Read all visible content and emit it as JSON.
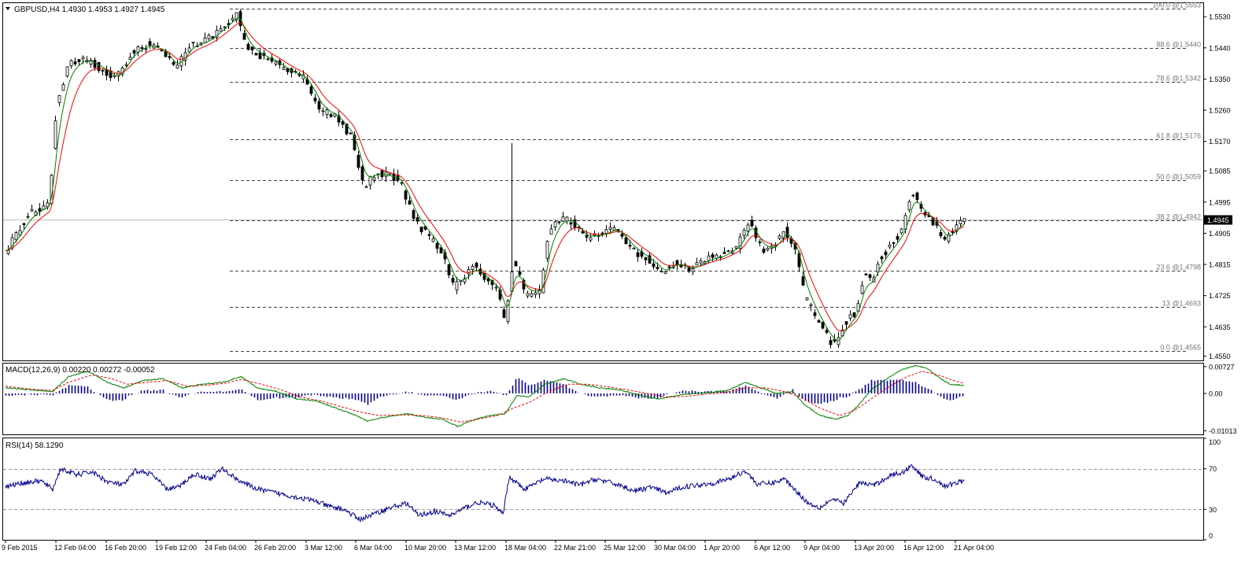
{
  "chart_data": [
    {
      "type": "candlestick",
      "symbol_header": "GBPUSD,H4  1.4930 1.4953 1.4927 1.4945",
      "current_price": "1.4945",
      "y_ticks": [
        "1.5530",
        "1.5440",
        "1.5350",
        "1.5260",
        "1.5170",
        "1.5085",
        "1.4995",
        "1.4905",
        "1.4815",
        "1.4725",
        "1.4635",
        "1.4550"
      ],
      "ylim": [
        1.4538,
        1.5569
      ],
      "fibonacci_levels": [
        {
          "label": "100.0 @1.5553",
          "value": 1.5553
        },
        {
          "label": "88.6 @1.5440",
          "value": 1.544
        },
        {
          "label": "78.6 @1.5342",
          "value": 1.5342
        },
        {
          "label": "61.8 @1.5176",
          "value": 1.5176
        },
        {
          "label": "50.0 @1.5059",
          "value": 1.5059
        },
        {
          "label": "38.2 @1.4942",
          "value": 1.4942
        },
        {
          "label": "23.6 @1.4798",
          "value": 1.4798
        },
        {
          "label": "13 @1.4693",
          "value": 1.4693
        },
        {
          "label": "0.0 @1.4565",
          "value": 1.4565
        }
      ],
      "price_anchors": [
        [
          0,
          1.4855
        ],
        [
          30,
          1.496
        ],
        [
          55,
          1.499
        ],
        [
          65,
          1.529
        ],
        [
          80,
          1.539
        ],
        [
          100,
          1.541
        ],
        [
          120,
          1.538
        ],
        [
          140,
          1.535
        ],
        [
          160,
          1.543
        ],
        [
          180,
          1.545
        ],
        [
          200,
          1.543
        ],
        [
          215,
          1.538
        ],
        [
          235,
          1.545
        ],
        [
          255,
          1.546
        ],
        [
          275,
          1.55
        ],
        [
          295,
          1.554
        ],
        [
          305,
          1.544
        ],
        [
          320,
          1.542
        ],
        [
          340,
          1.54
        ],
        [
          360,
          1.537
        ],
        [
          380,
          1.535
        ],
        [
          400,
          1.526
        ],
        [
          420,
          1.524
        ],
        [
          440,
          1.518
        ],
        [
          455,
          1.504
        ],
        [
          470,
          1.508
        ],
        [
          485,
          1.507
        ],
        [
          500,
          1.506
        ],
        [
          520,
          1.494
        ],
        [
          540,
          1.489
        ],
        [
          555,
          1.484
        ],
        [
          570,
          1.475
        ],
        [
          580,
          1.477
        ],
        [
          595,
          1.481
        ],
        [
          610,
          1.477
        ],
        [
          625,
          1.474
        ],
        [
          635,
          1.465
        ],
        [
          645,
          1.483
        ],
        [
          660,
          1.473
        ],
        [
          680,
          1.474
        ],
        [
          690,
          1.491
        ],
        [
          705,
          1.495
        ],
        [
          720,
          1.494
        ],
        [
          735,
          1.489
        ],
        [
          755,
          1.49
        ],
        [
          775,
          1.492
        ],
        [
          795,
          1.486
        ],
        [
          815,
          1.483
        ],
        [
          835,
          1.479
        ],
        [
          850,
          1.482
        ],
        [
          870,
          1.48
        ],
        [
          890,
          1.483
        ],
        [
          910,
          1.484
        ],
        [
          930,
          1.487
        ],
        [
          945,
          1.494
        ],
        [
          960,
          1.486
        ],
        [
          975,
          1.486
        ],
        [
          990,
          1.492
        ],
        [
          1005,
          1.484
        ],
        [
          1015,
          1.472
        ],
        [
          1030,
          1.466
        ],
        [
          1045,
          1.46
        ],
        [
          1055,
          1.458
        ],
        [
          1065,
          1.464
        ],
        [
          1080,
          1.468
        ],
        [
          1090,
          1.478
        ],
        [
          1100,
          1.477
        ],
        [
          1110,
          1.483
        ],
        [
          1125,
          1.487
        ],
        [
          1140,
          1.492
        ],
        [
          1152,
          1.503
        ],
        [
          1165,
          1.496
        ],
        [
          1180,
          1.493
        ],
        [
          1195,
          1.488
        ],
        [
          1205,
          1.492
        ],
        [
          1218,
          1.4945
        ]
      ],
      "moving_averages": [
        {
          "color": "#ff0000",
          "smoothing": 0.06
        },
        {
          "color": "#008000",
          "smoothing": 0.13
        }
      ]
    },
    {
      "type": "line",
      "indicator_label": "MACD(12,26,9) 0.00220 0.00272 -0.00052",
      "y_ticks": [
        "0.00727",
        "0.00",
        "-0.01013"
      ],
      "ylim": [
        -0.0111,
        0.0081
      ],
      "series": [
        {
          "role": "macd",
          "color": "#008000",
          "anchors": [
            [
              0,
              0.0015
            ],
            [
              30,
              0.001
            ],
            [
              60,
              0.0005
            ],
            [
              80,
              0.0045
            ],
            [
              105,
              0.006
            ],
            [
              130,
              0.003
            ],
            [
              150,
              0.0015
            ],
            [
              175,
              0.0035
            ],
            [
              200,
              0.004
            ],
            [
              225,
              0.0015
            ],
            [
              250,
              0.0025
            ],
            [
              275,
              0.003
            ],
            [
              300,
              0.0045
            ],
            [
              320,
              0.0015
            ],
            [
              345,
              0.0005
            ],
            [
              370,
              -0.0015
            ],
            [
              395,
              -0.002
            ],
            [
              420,
              -0.004
            ],
            [
              440,
              -0.0055
            ],
            [
              460,
              -0.0075
            ],
            [
              480,
              -0.0065
            ],
            [
              510,
              -0.0055
            ],
            [
              535,
              -0.0065
            ],
            [
              555,
              -0.007
            ],
            [
              575,
              -0.009
            ],
            [
              590,
              -0.0075
            ],
            [
              615,
              -0.006
            ],
            [
              635,
              -0.0055
            ],
            [
              650,
              -0.0005
            ],
            [
              665,
              -0.001
            ],
            [
              685,
              0.0025
            ],
            [
              710,
              0.004
            ],
            [
              730,
              0.0025
            ],
            [
              755,
              0.0015
            ],
            [
              780,
              0.001
            ],
            [
              805,
              -0.0005
            ],
            [
              830,
              -0.0015
            ],
            [
              855,
              -0.0005
            ],
            [
              880,
              0.0
            ],
            [
              905,
              0.0005
            ],
            [
              920,
              0.001
            ],
            [
              940,
              0.003
            ],
            [
              960,
              0.0015
            ],
            [
              980,
              0.0
            ],
            [
              1000,
              0.0005
            ],
            [
              1015,
              -0.003
            ],
            [
              1035,
              -0.006
            ],
            [
              1055,
              -0.007
            ],
            [
              1070,
              -0.006
            ],
            [
              1085,
              -0.003
            ],
            [
              1100,
              0.001
            ],
            [
              1120,
              0.004
            ],
            [
              1140,
              0.0065
            ],
            [
              1155,
              0.0075
            ],
            [
              1170,
              0.007
            ],
            [
              1185,
              0.0045
            ],
            [
              1200,
              0.0025
            ],
            [
              1218,
              0.0022
            ]
          ]
        },
        {
          "role": "signal",
          "color": "#ff0000",
          "anchors": [
            [
              0,
              0.002
            ],
            [
              30,
              0.0012
            ],
            [
              60,
              0.0008
            ],
            [
              80,
              0.003
            ],
            [
              110,
              0.005
            ],
            [
              135,
              0.004
            ],
            [
              155,
              0.0025
            ],
            [
              180,
              0.003
            ],
            [
              205,
              0.0035
            ],
            [
              230,
              0.002
            ],
            [
              255,
              0.0022
            ],
            [
              280,
              0.0028
            ],
            [
              300,
              0.0038
            ],
            [
              325,
              0.0025
            ],
            [
              350,
              0.001
            ],
            [
              375,
              -0.001
            ],
            [
              400,
              -0.002
            ],
            [
              425,
              -0.0035
            ],
            [
              450,
              -0.005
            ],
            [
              475,
              -0.006
            ],
            [
              505,
              -0.0058
            ],
            [
              530,
              -0.006
            ],
            [
              555,
              -0.0066
            ],
            [
              578,
              -0.0078
            ],
            [
              600,
              -0.007
            ],
            [
              625,
              -0.006
            ],
            [
              645,
              -0.004
            ],
            [
              665,
              -0.0025
            ],
            [
              690,
              0.0005
            ],
            [
              715,
              0.0025
            ],
            [
              740,
              0.0025
            ],
            [
              765,
              0.0018
            ],
            [
              790,
              0.001
            ],
            [
              815,
              0.0
            ],
            [
              840,
              -0.001
            ],
            [
              865,
              -0.0008
            ],
            [
              890,
              -0.0002
            ],
            [
              915,
              0.0003
            ],
            [
              940,
              0.0015
            ],
            [
              965,
              0.0015
            ],
            [
              990,
              0.0005
            ],
            [
              1010,
              -0.001
            ],
            [
              1035,
              -0.004
            ],
            [
              1060,
              -0.006
            ],
            [
              1080,
              -0.0045
            ],
            [
              1100,
              -0.0015
            ],
            [
              1120,
              0.0015
            ],
            [
              1145,
              0.0045
            ],
            [
              1165,
              0.006
            ],
            [
              1185,
              0.005
            ],
            [
              1205,
              0.0035
            ],
            [
              1218,
              0.0027
            ]
          ]
        }
      ]
    },
    {
      "type": "line",
      "indicator_label": "RSI(14) 58.1290",
      "y_ticks": [
        "100",
        "70",
        "30",
        "0"
      ],
      "ylim": [
        0,
        100
      ],
      "levels": [
        70,
        30
      ],
      "series": [
        {
          "role": "rsi",
          "color": "#00008b",
          "anchors": [
            [
              0,
              52
            ],
            [
              20,
              56
            ],
            [
              45,
              58
            ],
            [
              60,
              50
            ],
            [
              70,
              70
            ],
            [
              90,
              64
            ],
            [
              110,
              67
            ],
            [
              130,
              57
            ],
            [
              150,
              54
            ],
            [
              165,
              68
            ],
            [
              185,
              65
            ],
            [
              205,
              50
            ],
            [
              220,
              52
            ],
            [
              240,
              65
            ],
            [
              260,
              60
            ],
            [
              275,
              70
            ],
            [
              290,
              62
            ],
            [
              305,
              55
            ],
            [
              320,
              50
            ],
            [
              345,
              46
            ],
            [
              370,
              42
            ],
            [
              395,
              38
            ],
            [
              410,
              33
            ],
            [
              430,
              30
            ],
            [
              450,
              20
            ],
            [
              470,
              26
            ],
            [
              490,
              32
            ],
            [
              510,
              36
            ],
            [
              525,
              24
            ],
            [
              545,
              28
            ],
            [
              565,
              24
            ],
            [
              585,
              32
            ],
            [
              600,
              37
            ],
            [
              620,
              34
            ],
            [
              632,
              25
            ],
            [
              640,
              62
            ],
            [
              660,
              50
            ],
            [
              685,
              60
            ],
            [
              710,
              58
            ],
            [
              730,
              54
            ],
            [
              750,
              60
            ],
            [
              780,
              54
            ],
            [
              800,
              48
            ],
            [
              820,
              52
            ],
            [
              840,
              46
            ],
            [
              860,
              52
            ],
            [
              880,
              54
            ],
            [
              900,
              56
            ],
            [
              920,
              60
            ],
            [
              940,
              68
            ],
            [
              955,
              55
            ],
            [
              975,
              56
            ],
            [
              990,
              60
            ],
            [
              1005,
              48
            ],
            [
              1020,
              36
            ],
            [
              1035,
              32
            ],
            [
              1050,
              40
            ],
            [
              1065,
              36
            ],
            [
              1085,
              56
            ],
            [
              1105,
              54
            ],
            [
              1125,
              64
            ],
            [
              1140,
              66
            ],
            [
              1152,
              74
            ],
            [
              1165,
              62
            ],
            [
              1180,
              60
            ],
            [
              1195,
              52
            ],
            [
              1205,
              56
            ],
            [
              1218,
              58
            ]
          ]
        }
      ]
    }
  ],
  "x_axis": {
    "labels": [
      "9 Feb 2015",
      "12 Feb 04:00",
      "16 Feb 20:00",
      "19 Feb 12:00",
      "24 Feb 04:00",
      "26 Feb 20:00",
      "3 Mar 12:00",
      "6 Mar 04:00",
      "10 Mar 20:00",
      "13 Mar 12:00",
      "18 Mar 04:00",
      "22 Mar 21:00",
      "25 Mar 12:00",
      "30 Mar 04:00",
      "1 Apr 20:00",
      "6 Apr 12:00",
      "9 Apr 04:00",
      "13 Apr 20:00",
      "16 Apr 12:00",
      "21 Apr 04:00"
    ],
    "label_bars": [
      0,
      64,
      128,
      192,
      255,
      318,
      382,
      445,
      509,
      572,
      636,
      699,
      762,
      826,
      889,
      953,
      1016,
      1080,
      1143,
      1207
    ]
  }
}
